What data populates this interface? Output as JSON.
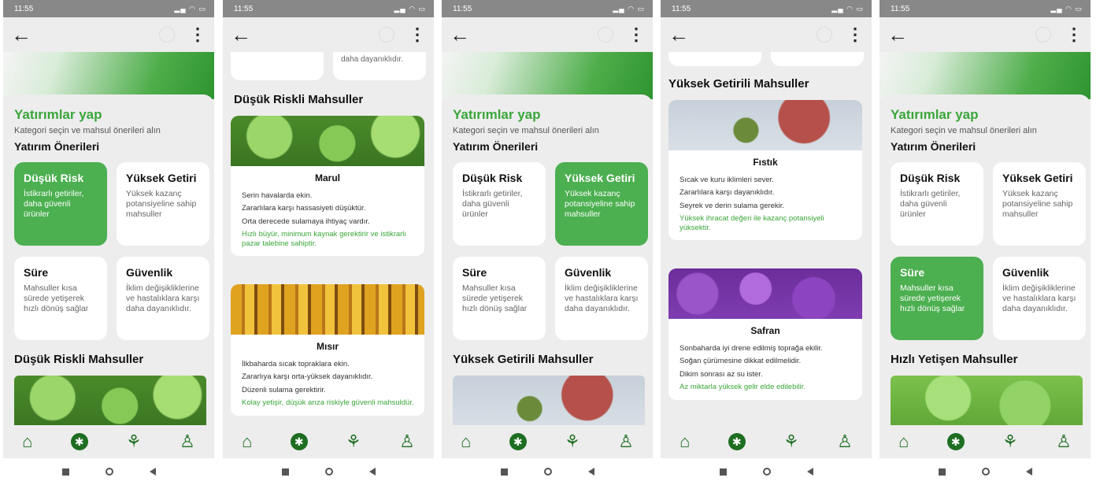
{
  "status": {
    "time": "11:55",
    "battery": "98"
  },
  "common": {
    "title": "Yatırımlar yap",
    "subtitle": "Kategori seçin ve mahsul önerileri alın",
    "section": "Yatırım Önerileri",
    "categories": [
      {
        "title": "Düşük Risk",
        "desc": "İstikrarlı getiriler, daha güvenli ürünler"
      },
      {
        "title": "Yüksek Getiri",
        "desc": "Yüksek kazanç potansiyeline sahip mahsuller"
      },
      {
        "title": "Süre",
        "desc": "Mahsuller kısa sürede yetişerek hızlı dönüş sağlar"
      },
      {
        "title": "Güvenlik",
        "desc": "İklim değişikliklerine ve hastalıklara karşı daha dayanıklıdır."
      }
    ]
  },
  "screens": [
    {
      "selected": 0,
      "listhead": "Düşük Riskli Mahsuller"
    },
    {
      "listhead": "Düşük Riskli Mahsuller",
      "stub_right": "daha dayanıklıdır."
    },
    {
      "selected": 1,
      "listhead": "Yüksek Getirili Mahsuller"
    },
    {
      "listhead": "Yüksek Getirili Mahsuller"
    },
    {
      "selected": 2,
      "listhead": "Hızlı Yetişen Mahsuller"
    }
  ],
  "crops": {
    "marul": {
      "name": "Marul",
      "lines": [
        "Serin havalarda ekin.",
        "Zararlılara karşı hassasiyeti düşüktür.",
        "Orta derecede sulamaya ihtiyaç vardır."
      ],
      "highlight": "Hızlı büyür, minimum kaynak gerektirir ve istikrarlı pazar talebine sahiptir."
    },
    "misir": {
      "name": "Mısır",
      "lines": [
        "İlkbaharda sıcak topraklara ekin.",
        "Zararlıya karşı orta-yüksek dayanıklıdır.",
        "Düzenli sulama gerektirir."
      ],
      "highlight": "Kolay yetişir, düşük arıza riskiyle güvenli mahsuldür."
    },
    "fistik": {
      "name": "Fıstık",
      "lines": [
        "Sıcak ve kuru iklimleri sever.",
        "Zararlılara karşı dayanıklıdır.",
        "Seyrek ve derin sulama gerekir."
      ],
      "highlight": "Yüksek ihracat değeri ile kazanç potansiyeli yüksektir."
    },
    "safran": {
      "name": "Safran",
      "lines": [
        "Sonbaharda iyi drene edilmiş toprağa ekilir.",
        "Soğan çürümesine dikkat edilmelidir.",
        "Dikim sonrası az su ister."
      ],
      "highlight": "Az miktarla yüksek gelir elde edilebilir."
    }
  }
}
